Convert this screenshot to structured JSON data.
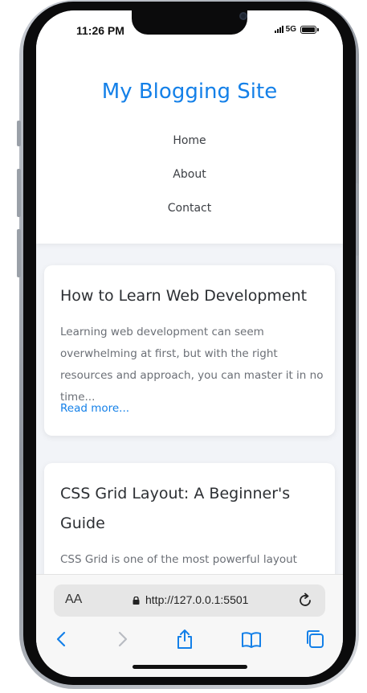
{
  "status_bar": {
    "time": "11:26 PM",
    "network": "5G"
  },
  "site": {
    "title": "My Blogging Site",
    "title_color": "#1480e8",
    "nav": [
      {
        "label": "Home"
      },
      {
        "label": "About"
      },
      {
        "label": "Contact"
      }
    ]
  },
  "posts": [
    {
      "title": "How to Learn Web Development",
      "excerpt": "Learning web development can seem overwhelming at first, but with the right resources and approach, you can master it in no time...",
      "link_label": "Read more..."
    },
    {
      "title": "CSS Grid Layout: A Beginner's Guide",
      "excerpt": "CSS Grid is one of the most powerful layout tools"
    }
  ],
  "browser": {
    "text_size_label": "AA",
    "url": "http://127.0.0.1:5501",
    "toolbar_icons": [
      "back-icon",
      "forward-icon",
      "share-icon",
      "bookmarks-icon",
      "tabs-icon"
    ]
  }
}
